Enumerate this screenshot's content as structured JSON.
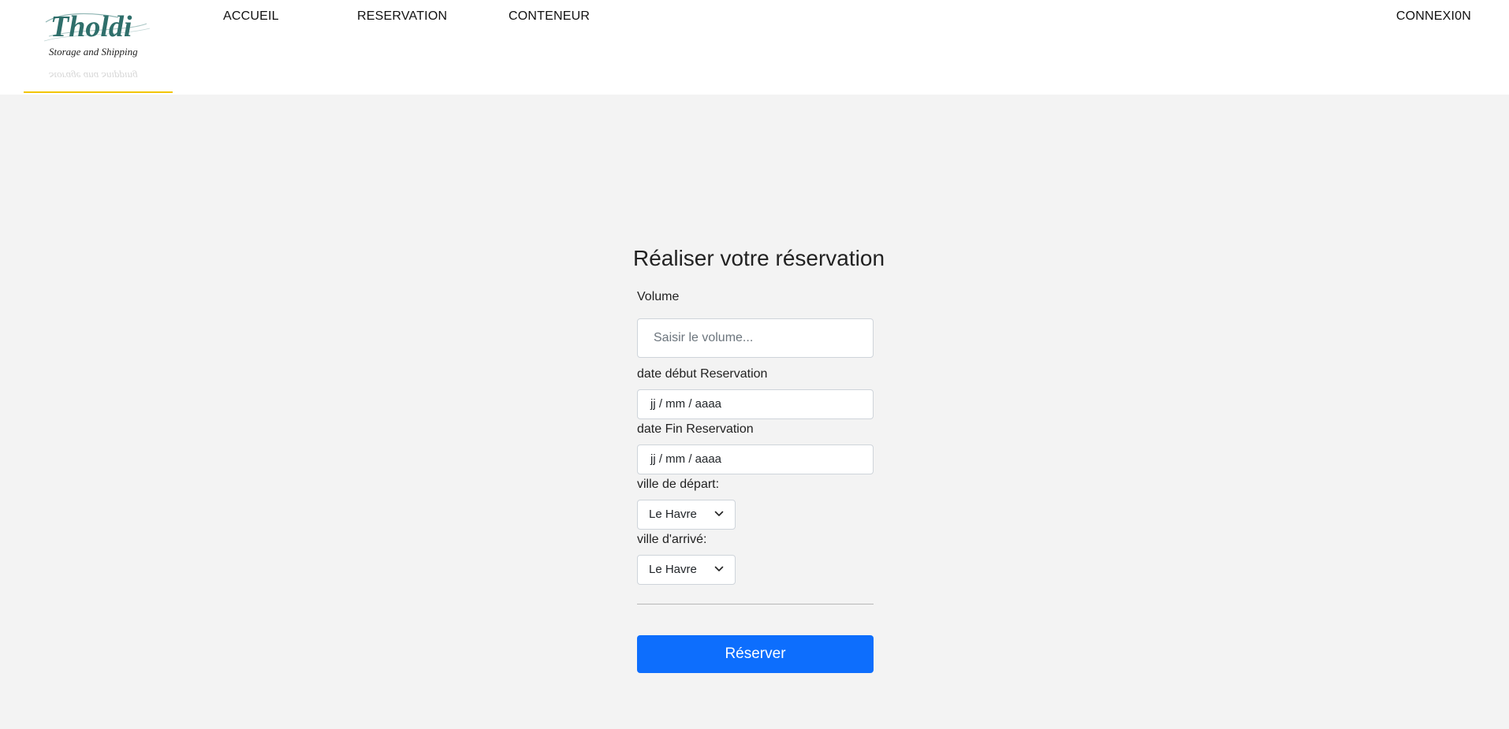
{
  "header": {
    "logo_text": "Tholdi",
    "logo_tagline": "Storage and Shipping",
    "accent_color": "#f2c500",
    "nav": {
      "accueil": "ACCUEIL",
      "reservation": "RESERVATION",
      "conteneur": "CONTENEUR"
    },
    "connexion": "CONNEXI0N"
  },
  "form": {
    "title": "Réaliser votre réservation",
    "volume_label": "Volume",
    "volume_placeholder": "Saisir le volume...",
    "date_debut_label": "date début Reservation",
    "date_debut_value": "jj / mm / aaaa",
    "date_fin_label": "date Fin Reservation",
    "date_fin_value": "jj / mm / aaaa",
    "ville_depart_label": "ville de départ:",
    "ville_depart_value": "Le Havre",
    "ville_arrive_label": "ville d'arrivé:",
    "ville_arrive_value": "Le Havre",
    "submit_label": "Réserver",
    "submit_color": "#0d6efd"
  }
}
